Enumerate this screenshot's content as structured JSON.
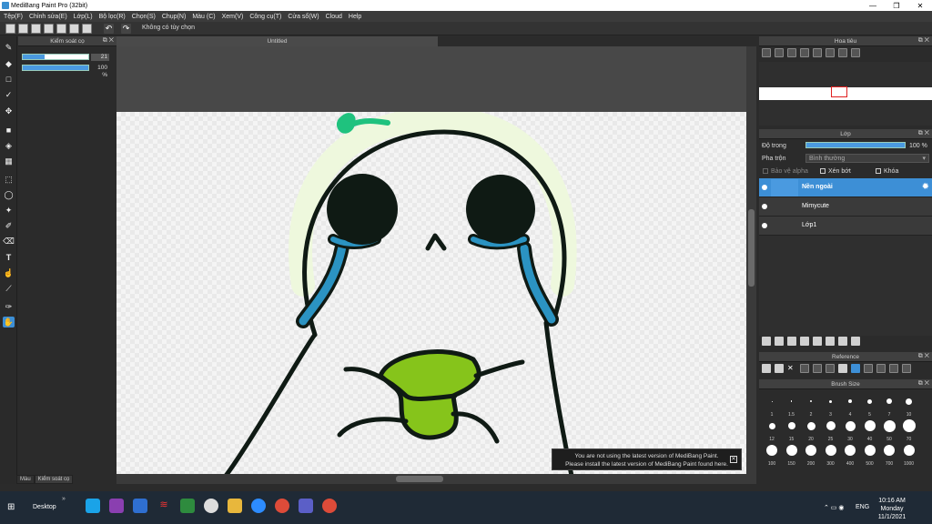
{
  "window": {
    "title": "MediBang Paint Pro (32bit)",
    "controls": [
      "—",
      "❐",
      "✕"
    ]
  },
  "menu": [
    "Tệp(F)",
    "Chỉnh sửa(E)",
    "Lớp(L)",
    "Bộ lọc(R)",
    "Chọn(S)",
    "Chụp(N)",
    "Màu (C)",
    "Xem(V)",
    "Công cụ(T)",
    "Cửa sổ(W)",
    "Cloud",
    "Help"
  ],
  "toolbar": {
    "hint": "Không có tùy chọn"
  },
  "brush_panel": {
    "title": "Kiểm soát cọ",
    "size_value": "21",
    "size_fill": 0.33,
    "opacity_value": "100 %",
    "opacity_fill": 1.0
  },
  "bottom_tabs": [
    "Màu",
    "Kiểm soát cọ"
  ],
  "document": {
    "tab": "Untitled"
  },
  "notification": {
    "line1": "You are not using the latest version of MediBang Paint.",
    "line2": "Please install the latest version of MediBang Paint found here.",
    "close": "✕"
  },
  "navigator": {
    "title": "Hoa tiêu"
  },
  "layers": {
    "title": "Lớp",
    "opacity_label": "Độ trong",
    "opacity_value": "100 %",
    "blend_label": "Pha trộn",
    "blend_value": "Bình thường",
    "protect_alpha": "Bảo vệ alpha",
    "clip": "Xén bớt",
    "lock": "Khóa",
    "items": [
      {
        "name": "Nền ngoài",
        "selected": true
      },
      {
        "name": "Mimycute",
        "selected": false
      },
      {
        "name": "Lớp1",
        "selected": false
      }
    ]
  },
  "reference": {
    "title": "Reference"
  },
  "brush_size": {
    "title": "Brush Size",
    "sizes": [
      "1",
      "1.5",
      "2",
      "3",
      "4",
      "5",
      "7",
      "10",
      "12",
      "15",
      "20",
      "25",
      "30",
      "40",
      "50",
      "70",
      "100",
      "150",
      "200",
      "300",
      "400",
      "500",
      "700",
      "1000"
    ]
  },
  "taskbar": {
    "desktop": "Desktop",
    "lang": "ENG",
    "time": "10:16 AM",
    "day": "Monday",
    "date": "11/1/2021"
  },
  "colors": {
    "accent": "#3d8fd6",
    "outline": "#0f1a14",
    "blue": "#2b93c2",
    "leaf": "#1fc27e",
    "green": "#86c41b",
    "glow": "#eef8dd"
  }
}
